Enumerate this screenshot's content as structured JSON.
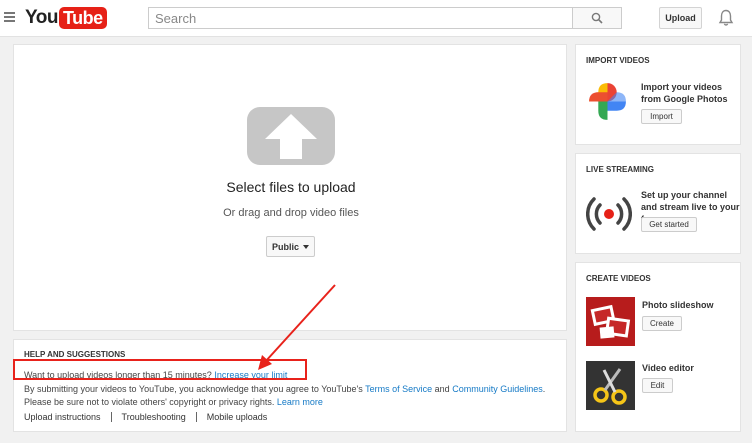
{
  "header": {
    "logo_you": "You",
    "logo_tube": "Tube",
    "search_placeholder": "Search",
    "upload_label": "Upload"
  },
  "upload": {
    "title": "Select files to upload",
    "subtitle": "Or drag and drop video files",
    "privacy_value": "Public"
  },
  "help": {
    "heading": "HELP AND SUGGESTIONS",
    "long_video_text": "Want to upload videos longer than 15 minutes?",
    "long_video_link": "Increase your limit",
    "terms_prefix": "By submitting your videos to YouTube, you acknowledge that you agree to YouTube's",
    "terms_link": "Terms of Service",
    "terms_and": "and",
    "guidelines_link": "Community Guidelines",
    "terms_suffix": ".",
    "copyright_text": "Please be sure not to violate others' copyright or privacy rights.",
    "learn_more_link": "Learn more",
    "links": [
      "Upload instructions",
      "Troubleshooting",
      "Mobile uploads"
    ]
  },
  "sidebar": {
    "import": {
      "title": "IMPORT VIDEOS",
      "text": "Import your videos from Google Photos",
      "button": "Import"
    },
    "live": {
      "title": "LIVE STREAMING",
      "text": "Set up your channel and stream live to your fans",
      "button": "Get started"
    },
    "create": {
      "title": "CREATE VIDEOS",
      "slideshow_label": "Photo slideshow",
      "slideshow_button": "Create",
      "editor_label": "Video editor",
      "editor_button": "Edit"
    }
  },
  "colors": {
    "brand_red": "#e62117",
    "link_blue": "#167ac6",
    "annotation_red": "#e8221b"
  }
}
